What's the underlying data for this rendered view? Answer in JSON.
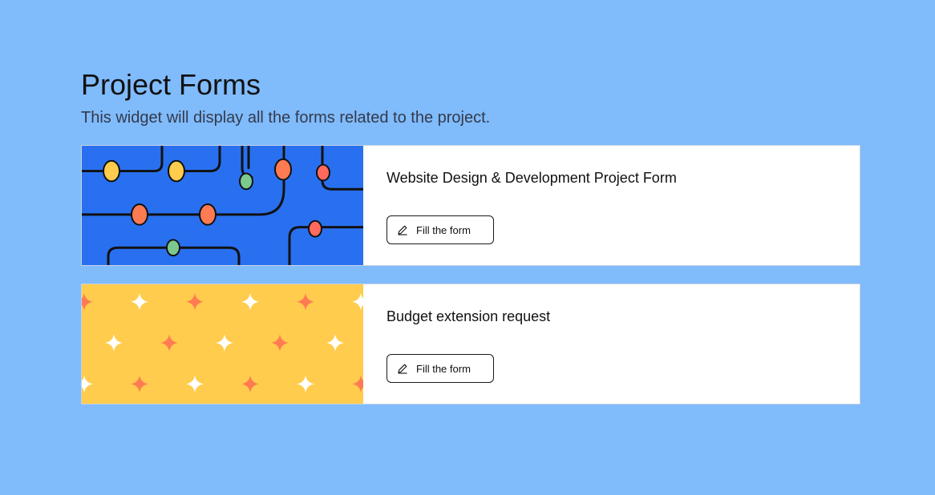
{
  "header": {
    "title": "Project Forms",
    "subtitle": "This widget will display all the forms related to the project."
  },
  "forms": [
    {
      "title": "Website Design & Development Project Form",
      "button_label": "Fill the form",
      "button_icon": "pencil-icon",
      "banner": "circuit-pattern",
      "banner_color": "#2970f0"
    },
    {
      "title": "Budget extension request",
      "button_label": "Fill the form",
      "button_icon": "pencil-icon",
      "banner": "sparkle-pattern",
      "banner_color": "#ffcc4d"
    }
  ],
  "colors": {
    "background": "#80bbfc",
    "card": "#ffffff",
    "accent_orange": "#ff7b52",
    "accent_yellow": "#ffcc4d",
    "accent_green": "#7cc98f",
    "accent_red": "#ff6a5c"
  }
}
